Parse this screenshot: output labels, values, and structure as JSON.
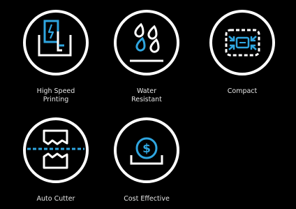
{
  "colors": {
    "background": "#000000",
    "stroke": "#ffffff",
    "accent": "#2fa6e0"
  },
  "features": [
    {
      "icon": "printer-icon",
      "label": "High Speed\nPrinting"
    },
    {
      "icon": "water-drops-icon",
      "label": "Water\nResistant"
    },
    {
      "icon": "compact-printer-icon",
      "label": "Compact"
    },
    {
      "icon": "cutter-icon",
      "label": "Auto Cutter"
    },
    {
      "icon": "dollar-coin-icon",
      "label": "Cost Effective"
    }
  ]
}
